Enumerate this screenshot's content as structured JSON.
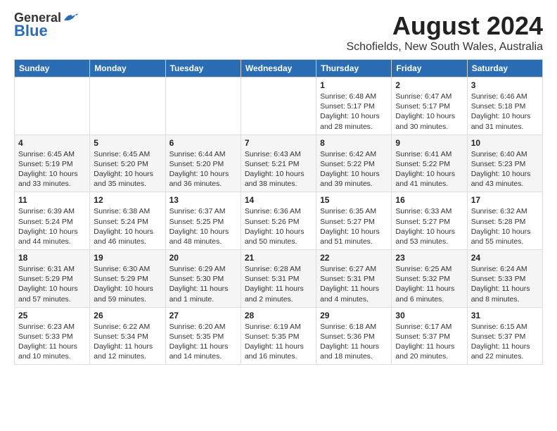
{
  "logo": {
    "general": "General",
    "blue": "Blue"
  },
  "title": "August 2024",
  "subtitle": "Schofields, New South Wales, Australia",
  "weekdays": [
    "Sunday",
    "Monday",
    "Tuesday",
    "Wednesday",
    "Thursday",
    "Friday",
    "Saturday"
  ],
  "weeks": [
    [
      {
        "day": "",
        "info": ""
      },
      {
        "day": "",
        "info": ""
      },
      {
        "day": "",
        "info": ""
      },
      {
        "day": "",
        "info": ""
      },
      {
        "day": "1",
        "info": "Sunrise: 6:48 AM\nSunset: 5:17 PM\nDaylight: 10 hours\nand 28 minutes."
      },
      {
        "day": "2",
        "info": "Sunrise: 6:47 AM\nSunset: 5:17 PM\nDaylight: 10 hours\nand 30 minutes."
      },
      {
        "day": "3",
        "info": "Sunrise: 6:46 AM\nSunset: 5:18 PM\nDaylight: 10 hours\nand 31 minutes."
      }
    ],
    [
      {
        "day": "4",
        "info": "Sunrise: 6:45 AM\nSunset: 5:19 PM\nDaylight: 10 hours\nand 33 minutes."
      },
      {
        "day": "5",
        "info": "Sunrise: 6:45 AM\nSunset: 5:20 PM\nDaylight: 10 hours\nand 35 minutes."
      },
      {
        "day": "6",
        "info": "Sunrise: 6:44 AM\nSunset: 5:20 PM\nDaylight: 10 hours\nand 36 minutes."
      },
      {
        "day": "7",
        "info": "Sunrise: 6:43 AM\nSunset: 5:21 PM\nDaylight: 10 hours\nand 38 minutes."
      },
      {
        "day": "8",
        "info": "Sunrise: 6:42 AM\nSunset: 5:22 PM\nDaylight: 10 hours\nand 39 minutes."
      },
      {
        "day": "9",
        "info": "Sunrise: 6:41 AM\nSunset: 5:22 PM\nDaylight: 10 hours\nand 41 minutes."
      },
      {
        "day": "10",
        "info": "Sunrise: 6:40 AM\nSunset: 5:23 PM\nDaylight: 10 hours\nand 43 minutes."
      }
    ],
    [
      {
        "day": "11",
        "info": "Sunrise: 6:39 AM\nSunset: 5:24 PM\nDaylight: 10 hours\nand 44 minutes."
      },
      {
        "day": "12",
        "info": "Sunrise: 6:38 AM\nSunset: 5:24 PM\nDaylight: 10 hours\nand 46 minutes."
      },
      {
        "day": "13",
        "info": "Sunrise: 6:37 AM\nSunset: 5:25 PM\nDaylight: 10 hours\nand 48 minutes."
      },
      {
        "day": "14",
        "info": "Sunrise: 6:36 AM\nSunset: 5:26 PM\nDaylight: 10 hours\nand 50 minutes."
      },
      {
        "day": "15",
        "info": "Sunrise: 6:35 AM\nSunset: 5:27 PM\nDaylight: 10 hours\nand 51 minutes."
      },
      {
        "day": "16",
        "info": "Sunrise: 6:33 AM\nSunset: 5:27 PM\nDaylight: 10 hours\nand 53 minutes."
      },
      {
        "day": "17",
        "info": "Sunrise: 6:32 AM\nSunset: 5:28 PM\nDaylight: 10 hours\nand 55 minutes."
      }
    ],
    [
      {
        "day": "18",
        "info": "Sunrise: 6:31 AM\nSunset: 5:29 PM\nDaylight: 10 hours\nand 57 minutes."
      },
      {
        "day": "19",
        "info": "Sunrise: 6:30 AM\nSunset: 5:29 PM\nDaylight: 10 hours\nand 59 minutes."
      },
      {
        "day": "20",
        "info": "Sunrise: 6:29 AM\nSunset: 5:30 PM\nDaylight: 11 hours\nand 1 minute."
      },
      {
        "day": "21",
        "info": "Sunrise: 6:28 AM\nSunset: 5:31 PM\nDaylight: 11 hours\nand 2 minutes."
      },
      {
        "day": "22",
        "info": "Sunrise: 6:27 AM\nSunset: 5:31 PM\nDaylight: 11 hours\nand 4 minutes."
      },
      {
        "day": "23",
        "info": "Sunrise: 6:25 AM\nSunset: 5:32 PM\nDaylight: 11 hours\nand 6 minutes."
      },
      {
        "day": "24",
        "info": "Sunrise: 6:24 AM\nSunset: 5:33 PM\nDaylight: 11 hours\nand 8 minutes."
      }
    ],
    [
      {
        "day": "25",
        "info": "Sunrise: 6:23 AM\nSunset: 5:33 PM\nDaylight: 11 hours\nand 10 minutes."
      },
      {
        "day": "26",
        "info": "Sunrise: 6:22 AM\nSunset: 5:34 PM\nDaylight: 11 hours\nand 12 minutes."
      },
      {
        "day": "27",
        "info": "Sunrise: 6:20 AM\nSunset: 5:35 PM\nDaylight: 11 hours\nand 14 minutes."
      },
      {
        "day": "28",
        "info": "Sunrise: 6:19 AM\nSunset: 5:35 PM\nDaylight: 11 hours\nand 16 minutes."
      },
      {
        "day": "29",
        "info": "Sunrise: 6:18 AM\nSunset: 5:36 PM\nDaylight: 11 hours\nand 18 minutes."
      },
      {
        "day": "30",
        "info": "Sunrise: 6:17 AM\nSunset: 5:37 PM\nDaylight: 11 hours\nand 20 minutes."
      },
      {
        "day": "31",
        "info": "Sunrise: 6:15 AM\nSunset: 5:37 PM\nDaylight: 11 hours\nand 22 minutes."
      }
    ]
  ],
  "colors": {
    "header_bg": "#2a6db5",
    "header_text": "#ffffff",
    "accent": "#2a6db5"
  }
}
